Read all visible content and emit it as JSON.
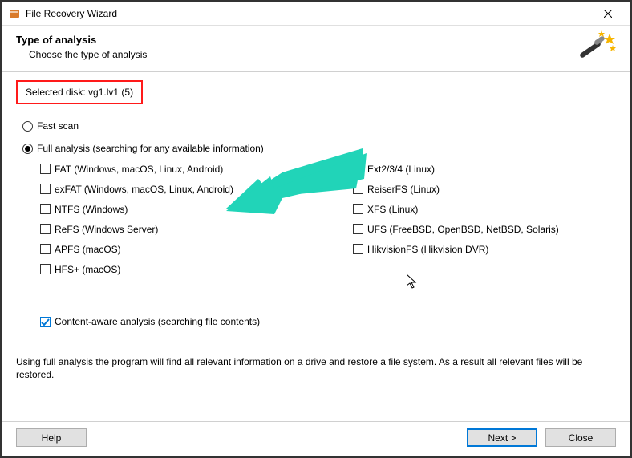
{
  "window": {
    "title": "File Recovery Wizard"
  },
  "header": {
    "title": "Type of analysis",
    "subtitle": "Choose the type of analysis"
  },
  "selected_disk_label": "Selected disk: vg1.lv1 (5)",
  "modes": {
    "fast": {
      "label": "Fast scan",
      "selected": false
    },
    "full": {
      "label": "Full analysis (searching for any available information)",
      "selected": true
    }
  },
  "filesystems_left": [
    {
      "label": "FAT (Windows, macOS, Linux, Android)",
      "checked": false
    },
    {
      "label": "exFAT (Windows, macOS, Linux, Android)",
      "checked": false
    },
    {
      "label": "NTFS (Windows)",
      "checked": false
    },
    {
      "label": "ReFS (Windows Server)",
      "checked": false
    },
    {
      "label": "APFS (macOS)",
      "checked": false
    },
    {
      "label": "HFS+ (macOS)",
      "checked": false
    }
  ],
  "filesystems_right": [
    {
      "label": "Ext2/3/4 (Linux)",
      "checked": true
    },
    {
      "label": "ReiserFS (Linux)",
      "checked": false
    },
    {
      "label": "XFS (Linux)",
      "checked": false
    },
    {
      "label": "UFS (FreeBSD, OpenBSD, NetBSD, Solaris)",
      "checked": false
    },
    {
      "label": "HikvisionFS (Hikvision DVR)",
      "checked": false
    }
  ],
  "content_aware": {
    "label": "Content-aware analysis (searching file contents)",
    "checked": true
  },
  "description": "Using full analysis the program will find all relevant information on a drive and restore a file system. As a result all relevant files will be restored.",
  "buttons": {
    "help": "Help",
    "next": "Next >",
    "close": "Close"
  },
  "annotations": {
    "arrow_color": "#21d4b8",
    "highlight_color": "#ff1a1a"
  }
}
